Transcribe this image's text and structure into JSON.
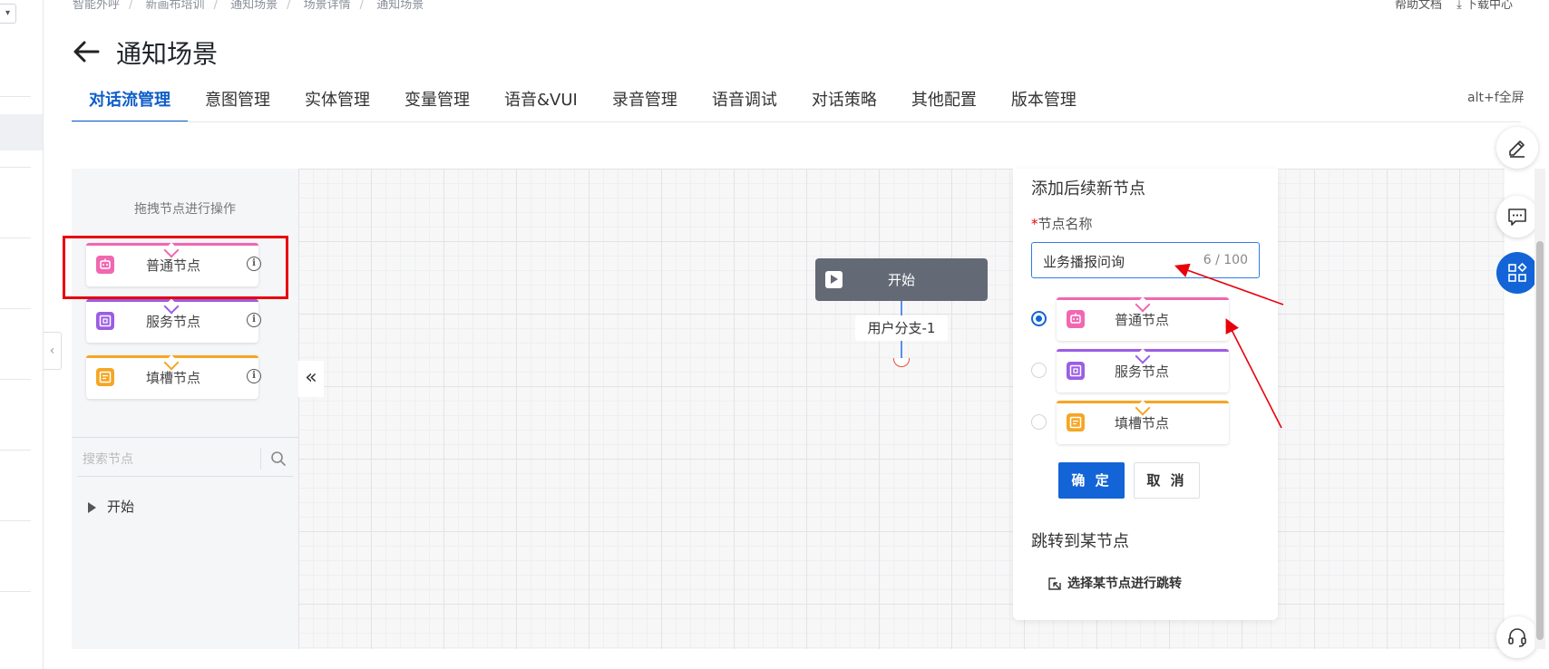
{
  "breadcrumb": [
    "智能外呼",
    "新画布培训",
    "通知场景",
    "场景详情",
    "通知场景"
  ],
  "top_right": {
    "help": "帮助文档",
    "download": "下载中心"
  },
  "page_title": "通知场景",
  "tabs": [
    {
      "label": "对话流管理",
      "active": true
    },
    {
      "label": "意图管理"
    },
    {
      "label": "实体管理"
    },
    {
      "label": "变量管理"
    },
    {
      "label": "语音&VUI"
    },
    {
      "label": "录音管理"
    },
    {
      "label": "语音调试"
    },
    {
      "label": "对话策略"
    },
    {
      "label": "其他配置"
    },
    {
      "label": "版本管理"
    }
  ],
  "shortcut_hint": "alt+f全屏",
  "node_panel": {
    "hint": "拖拽节点进行操作",
    "nodes": [
      {
        "label": "普通节点",
        "color": "#f167b2",
        "icon": "robot-icon"
      },
      {
        "label": "服务节点",
        "color": "#9b5de5",
        "icon": "service-icon"
      },
      {
        "label": "填槽节点",
        "color": "#f5a623",
        "icon": "slot-icon"
      }
    ],
    "search_placeholder": "搜索节点",
    "tree": [
      {
        "label": "开始"
      }
    ]
  },
  "flow": {
    "start_label": "开始",
    "branch_label": "用户分支-1",
    "start_color": "#646a75",
    "line_color": "#5b8def"
  },
  "add_panel": {
    "title": "添加后续新节点",
    "name_label": "节点名称",
    "required_mark": "*",
    "name_value": "业务播报问询",
    "counter": "6 / 100",
    "options": [
      {
        "label": "普通节点",
        "color": "#f167b2",
        "selected": true
      },
      {
        "label": "服务节点",
        "color": "#9b5de5",
        "selected": false
      },
      {
        "label": "填槽节点",
        "color": "#f5a623",
        "selected": false
      }
    ],
    "confirm": "确 定",
    "cancel": "取 消",
    "jump_title": "跳转到某节点",
    "jump_link": "选择某节点进行跳转"
  },
  "colors": {
    "accent": "#1364d6",
    "annotation": "#e8000b"
  }
}
